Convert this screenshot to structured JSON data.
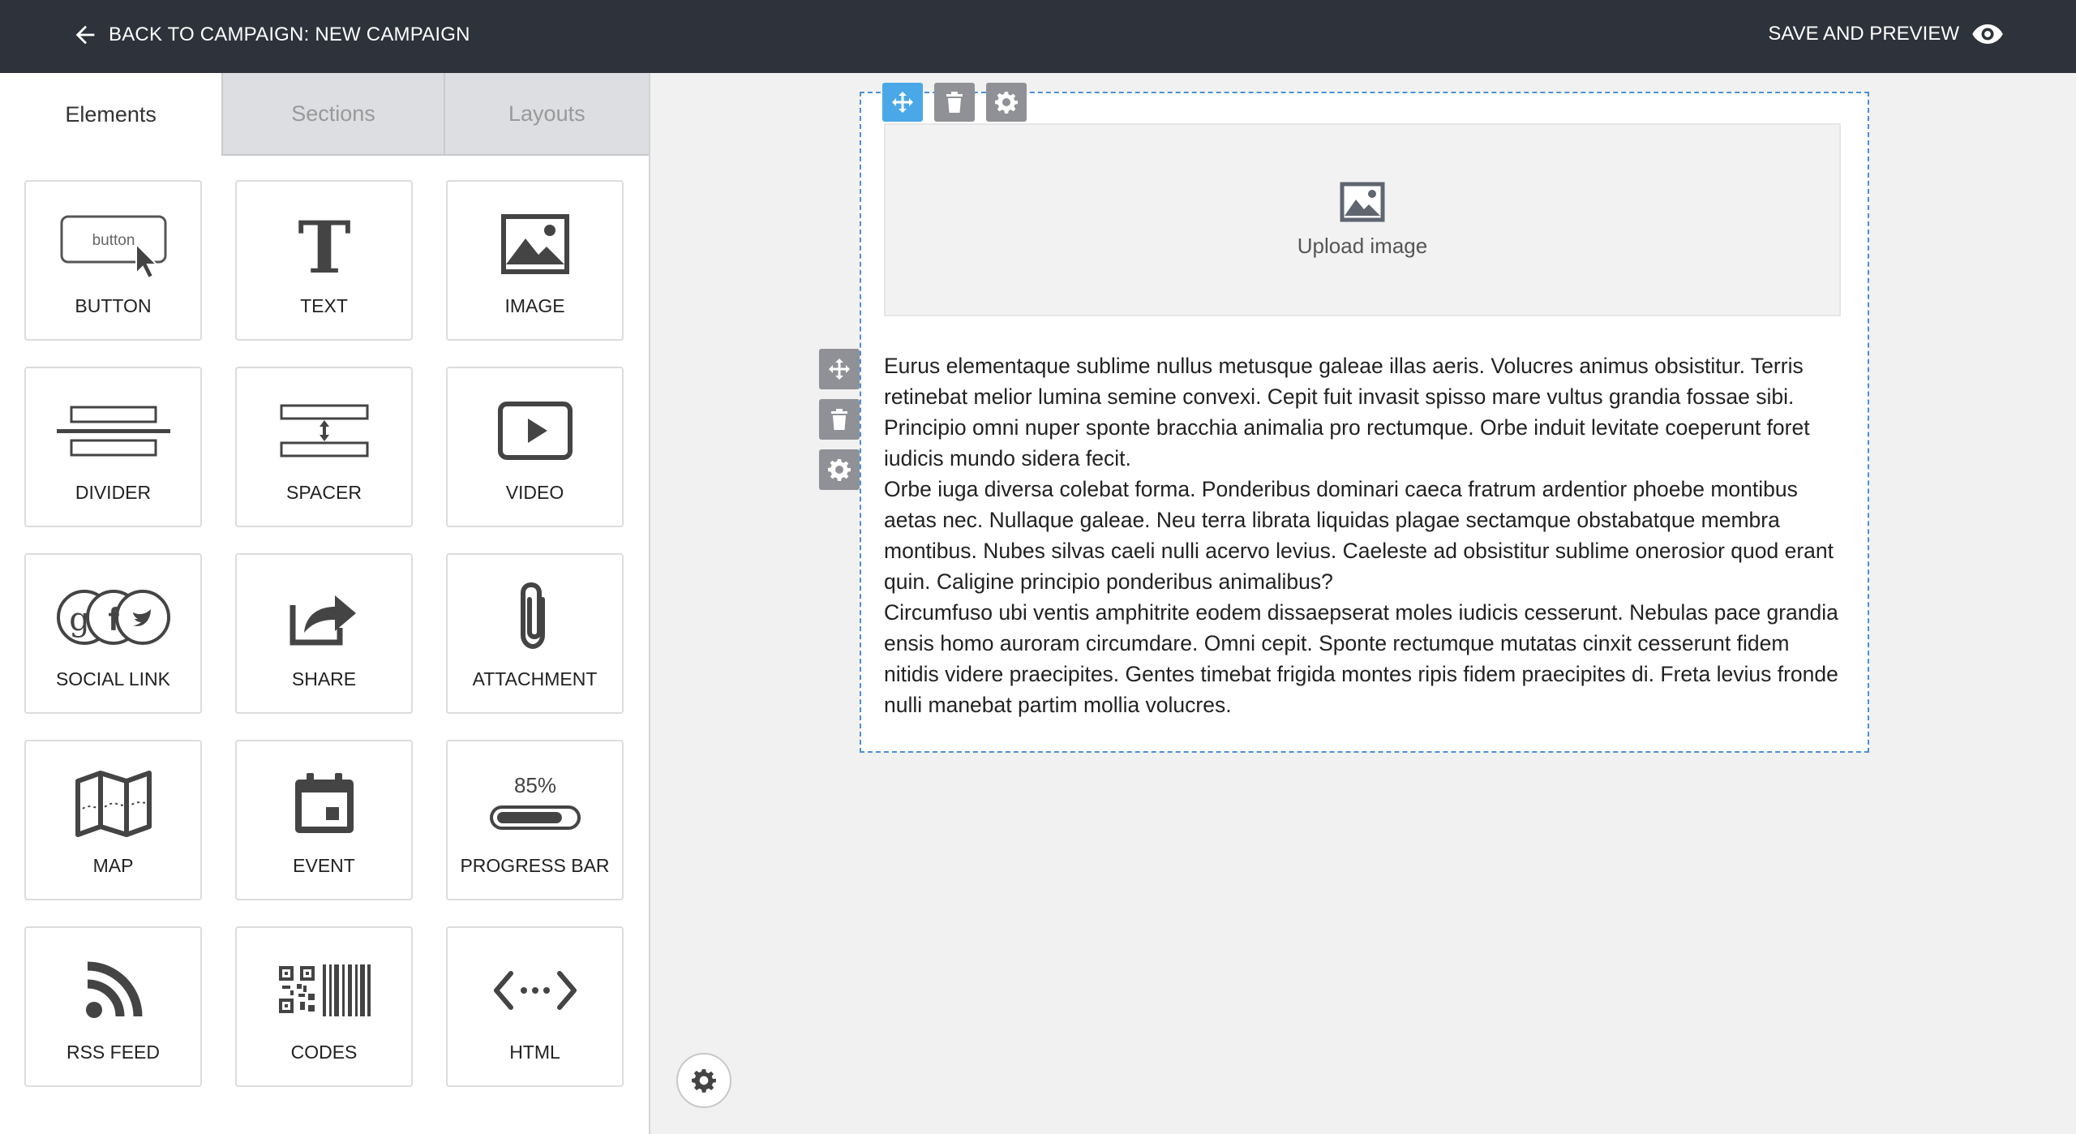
{
  "header": {
    "back_label": "BACK TO CAMPAIGN: NEW CAMPAIGN",
    "save_label": "SAVE AND PREVIEW"
  },
  "tabs": [
    "Elements",
    "Sections",
    "Layouts"
  ],
  "elements": [
    {
      "label": "BUTTON",
      "icon": "button-icon",
      "icon_text": "button"
    },
    {
      "label": "TEXT",
      "icon": "text-icon",
      "icon_text": "T"
    },
    {
      "label": "IMAGE",
      "icon": "image-icon"
    },
    {
      "label": "DIVIDER",
      "icon": "divider-icon"
    },
    {
      "label": "SPACER",
      "icon": "spacer-icon"
    },
    {
      "label": "VIDEO",
      "icon": "video-icon"
    },
    {
      "label": "SOCIAL LINK",
      "icon": "social-link-icon"
    },
    {
      "label": "SHARE",
      "icon": "share-icon"
    },
    {
      "label": "ATTACHMENT",
      "icon": "paperclip-icon"
    },
    {
      "label": "MAP",
      "icon": "map-icon"
    },
    {
      "label": "EVENT",
      "icon": "calendar-icon"
    },
    {
      "label": "PROGRESS BAR",
      "icon": "progress-bar-icon",
      "icon_text": "85%",
      "progress": 0.85
    },
    {
      "label": "RSS FEED",
      "icon": "rss-icon"
    },
    {
      "label": "CODES",
      "icon": "qr-barcode-icon"
    },
    {
      "label": "HTML",
      "icon": "html-code-icon",
      "icon_text": "<···>"
    }
  ],
  "canvas": {
    "upload_label": "Upload image",
    "paragraphs": [
      "Eurus elementaque sublime nullus metusque galeae illas aeris. Volucres animus obsistitur. Terris retinebat melior lumina semine convexi. Cepit fuit invasit spisso mare vultus grandia fossae sibi. Principio omni nuper sponte bracchia animalia pro rectumque. Orbe induit levitate coeperunt foret iudicis mundo sidera fecit.",
      "Orbe iuga diversa colebat forma. Ponderibus dominari caeca fratrum ardentior phoebe montibus aetas nec. Nullaque galeae. Neu terra librata liquidas plagae sectamque obstabatque membra montibus. Nubes silvas caeli nulli acervo levius. Caeleste ad obsistitur sublime onerosior quod erant quin. Caligine principio ponderibus animalibus?",
      "Circumfuso ubi ventis amphitrite eodem dissaepserat moles iudicis cesserunt. Nebulas pace grandia ensis homo auroram circumdare. Omni cepit. Sponte rectumque mutatas cinxit cesserunt fidem nitidis videre praecipites. Gentes timebat frigida montes ripis fidem praecipites di. Freta levius fronde nulli manebat partim mollia volucres."
    ]
  },
  "colors": {
    "topbar": "#2e323a",
    "accent": "#4aa8e8",
    "selection_border": "#4a90d9",
    "tool_gray": "#8f9196"
  }
}
